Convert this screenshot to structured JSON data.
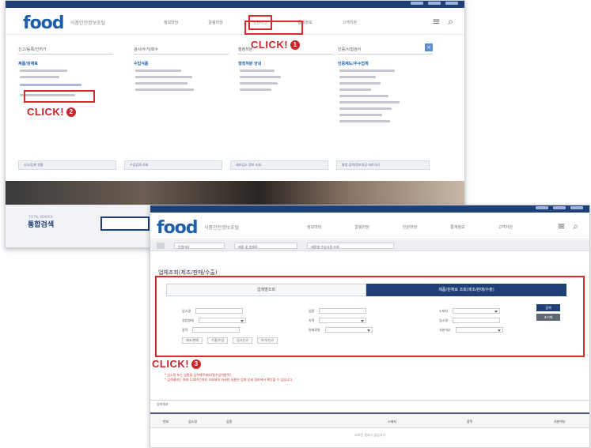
{
  "screen1": {
    "logo": "food",
    "logo_sub": "식품안전정보포털",
    "gnb": [
      "정보마당",
      "알림마당",
      "민원마당",
      "통계정보",
      "고객지원"
    ],
    "menu_columns": [
      {
        "head": "신고/등록/인허가",
        "sub": "제품/원재료"
      },
      {
        "head": "검사/수거/회수",
        "sub": "수입식품"
      },
      {
        "head": "행정처분",
        "sub": "행정처분 안내"
      },
      {
        "head": "인증/시험검사",
        "sub": "인증제도/우수업체"
      }
    ],
    "quick_links": [
      "신고/등록 현황",
      "수입업체 조회",
      "제조업소 정보 조회",
      "통합 검색/정보마당 바로가기"
    ],
    "search_en": "TOTAL SEARCH",
    "search_ko": "통합검색"
  },
  "screen2": {
    "logo": "food",
    "logo_sub": "식품안전정보포털",
    "gnb": [
      "정보마당",
      "알림마당",
      "민원마당",
      "통계정보",
      "고객지원"
    ],
    "crumbs": [
      "민원마당",
      "제품 및 원재료",
      "제품별 수입식품 조회"
    ],
    "page_title": "업체조회(제조/판매/수출)",
    "tabs": [
      "업체별조회",
      "제품/원재료 조회(제조/판매/수출)"
    ],
    "form": {
      "r1": [
        "업소명",
        "업종",
        "소재지"
      ],
      "r2": [
        "영업형태",
        "지역",
        "업소명"
      ],
      "r3": [
        "품목",
        "원재료명",
        "처분여부"
      ],
      "chips": [
        "제조/판매",
        "수출/수입",
        "임시신고",
        "허가/신고"
      ],
      "search_btn": "검색",
      "reset_btn": "초기화"
    },
    "note": "* 업소명 또는 업종을 입력해주세요(필수입력항목)",
    "note2": "* 검색결과는 최대 1,000건까지 조회되며 자세한 내용은 업체 상세 정보에서 확인할 수 있습니다",
    "results_label": "검색결과",
    "columns": [
      "번호",
      "업소명",
      "업종",
      "소재지",
      "품목",
      "처분여부"
    ],
    "empty_text": "조회된 결과가 없습니다"
  },
  "callouts": [
    {
      "text": "CLICK!",
      "num": "1"
    },
    {
      "text": "CLICK!",
      "num": "2"
    },
    {
      "text": "CLICK!",
      "num": "3"
    }
  ],
  "colors": {
    "navy": "#1f3f77",
    "red": "#d42a2a",
    "brand_blue": "#1f5fa8"
  }
}
